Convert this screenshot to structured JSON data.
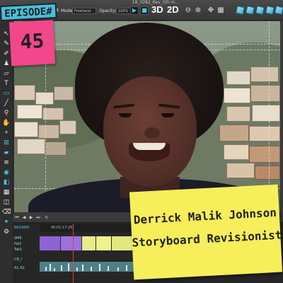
{
  "window": {
    "title": "18_0282_Rev_5th.m..."
  },
  "toolbar": {
    "mode_label": "Mode:",
    "mode_value": "Freehand",
    "opacity_label": "Opacity:",
    "opacity_value": "100%",
    "label_3d": "3D",
    "label_2d": "2D"
  },
  "episode": {
    "label": "EPISODE#",
    "number": "45"
  },
  "guest": {
    "name": "Derrick Malik Johnson",
    "role": "Storyboard Revisionist"
  },
  "timeline": {
    "track_label": "BKGRND",
    "ruler_time": "00:01:17:20",
    "rows": [
      "SMK",
      "Pal1",
      "Tak1",
      "CB_I",
      "A1 A2"
    ]
  },
  "colors": {
    "episode_pink": "#f2478a",
    "episode_blue": "#46c0da",
    "note_yellow": "#f6ee5a",
    "accent_blue": "#4fc3e8",
    "playhead_red": "#e23b3b"
  }
}
